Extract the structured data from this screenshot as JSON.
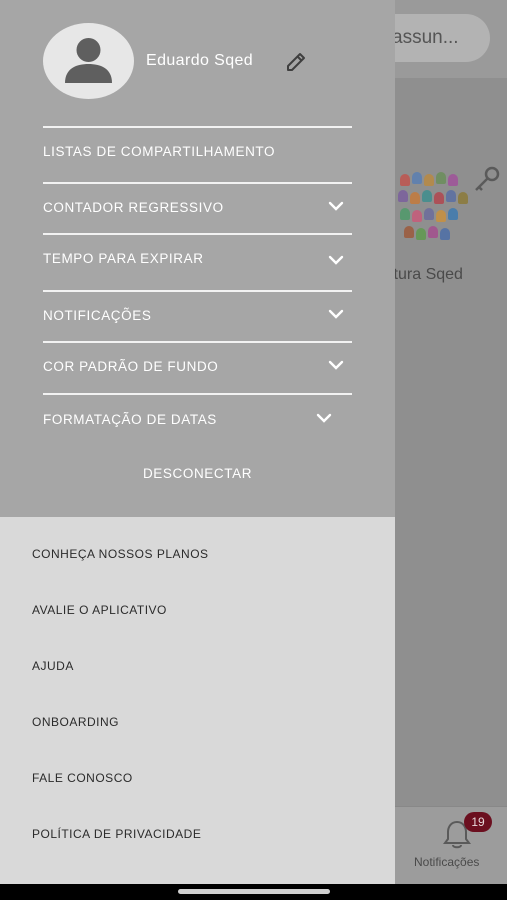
{
  "background": {
    "search_text": "assun...",
    "card_title": "ltura Sqed",
    "tab_notifications_label": "Notificações",
    "tab_notifications_badge": "19"
  },
  "drawer": {
    "user_name": "Eduardo Sqed",
    "menu": [
      {
        "label": "LISTAS DE COMPARTILHAMENTO",
        "expandable": false
      },
      {
        "label": "CONTADOR REGRESSIVO",
        "expandable": true
      },
      {
        "label": "TEMPO PARA EXPIRAR",
        "expandable": true
      },
      {
        "label": "NOTIFICAÇÕES",
        "expandable": true
      },
      {
        "label": "COR PADRÃO DE FUNDO",
        "expandable": true
      },
      {
        "label": "FORMATAÇÃO DE DATAS",
        "expandable": true
      }
    ],
    "logout_label": "DESCONECTAR",
    "links": [
      {
        "label": "CONHEÇA NOSSOS PLANOS"
      },
      {
        "label": "AVALIE O APLICATIVO"
      },
      {
        "label": "AJUDA"
      },
      {
        "label": "ONBOARDING"
      },
      {
        "label": "FALE CONOSCO"
      },
      {
        "label": "POLÍTICA DE PRIVACIDADE"
      }
    ]
  },
  "colors": {
    "drawer_top": "#a6a6a6",
    "drawer_bottom": "#d9d9d9",
    "badge": "#6b0f1f"
  }
}
